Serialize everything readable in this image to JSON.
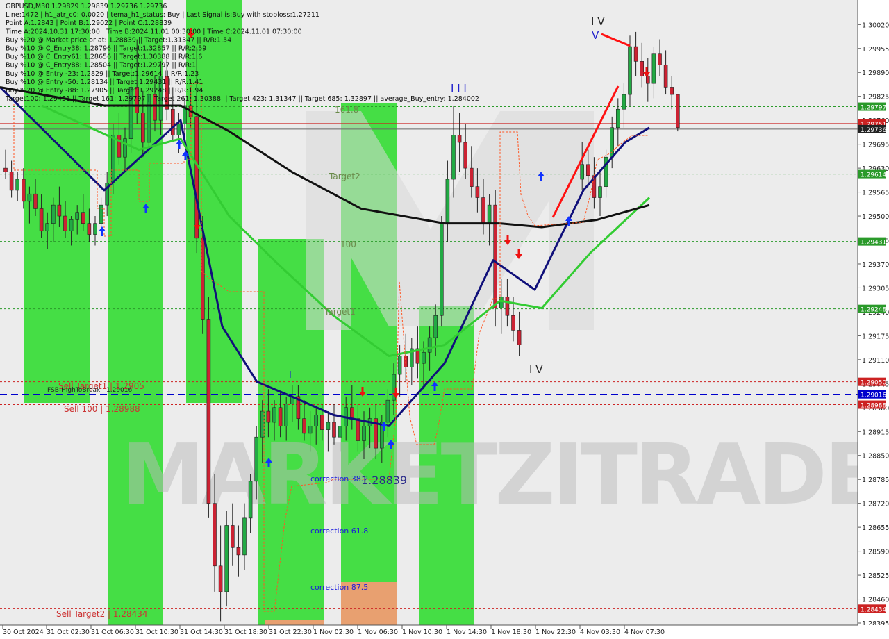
{
  "colors": {
    "background": "#ffffff",
    "plot_bg": "#ececec",
    "zone_green": "#33dd33",
    "zone_orange": "#e8a070",
    "bull": "#22aa44",
    "bear": "#cc2233",
    "ma_navy": "#10107a",
    "ma_green": "#33cc33",
    "ma_black": "#111111",
    "level_green": "#2a9a2a",
    "level_red": "#cc2222",
    "level_blue": "#0000cc"
  },
  "header_lines": [
    "GBPUSD,M30  1.29829 1.29839 1.29736 1.29736",
    "Line:1472 | h1_atr_c0: 0.0020 | tema_h1_status: Buy | Last Signal is:Buy with stoploss:1.27211",
    "Point A:1.2843 | Point B:1.29022 | Point C:1.28839",
    "Time A:2024.10.31 17:30:00 | Time B:2024.11.01 00:30:00 | Time C:2024.11.01 07:30:00",
    "Buy %20 @ Market price or at: 1.28839 || Target:1.31347 || R/R:1.54",
    "Buy %10 @ C_Entry38: 1.28796 || Target:1.32857 || R/R:2.59",
    "Buy %10 @ C_Entry61: 1.28656 || Target:1.30388 || R/R:1.6",
    "Buy %10 @ C_Entry88: 1.28504 || Target:1.29797 || R/R:1",
    "Buy %10 @ Entry -23: 1.2829 || Target:1.29614 || R/R:1.23",
    "Buy %10 @ Entry -50: 1.28134 || Target:1.29431 || R/R:1.41",
    "Buy %20 @ Entry -88: 1.27905 || Target:1.29248 || R/R:1.94",
    "Target100: 1.29431 || Target 161: 1.29797 || Target 261: 1.30388 || Target 423: 1.31347 || Target 685: 1.32897 || average_Buy_entry: 1.284002"
  ],
  "chart_data": {
    "type": "candlestick",
    "symbol": "GBPUSD",
    "timeframe": "M30",
    "ylim": [
      1.28395,
      1.3003
    ],
    "y_ticks": [
      "1.30020",
      "1.29955",
      "1.29890",
      "1.29825",
      "1.29760",
      "1.29695",
      "1.29630",
      "1.29565",
      "1.29500",
      "1.29435",
      "1.29370",
      "1.29305",
      "1.29240",
      "1.29175",
      "1.29110",
      "1.29045",
      "1.28980",
      "1.28915",
      "1.28850",
      "1.28785",
      "1.28720",
      "1.28655",
      "1.28590",
      "1.28525",
      "1.28460",
      "1.28395"
    ],
    "x_ticks": [
      "30 Oct 2024",
      "31 Oct 02:30",
      "31 Oct 06:30",
      "31 Oct 10:30",
      "31 Oct 14:30",
      "31 Oct 18:30",
      "31 Oct 22:30",
      "1 Nov 02:30",
      "1 Nov 06:30",
      "1 Nov 10:30",
      "1 Nov 14:30",
      "1 Nov 18:30",
      "1 Nov 22:30",
      "4 Nov 03:30",
      "4 Nov 07:30"
    ],
    "price_levels": [
      {
        "value": 1.29797,
        "label": "1.29797",
        "kind": "green"
      },
      {
        "value": 1.29751,
        "label": "1.29751",
        "kind": "red"
      },
      {
        "value": 1.29736,
        "label": "1.29736",
        "kind": "current"
      },
      {
        "value": 1.29614,
        "label": "1.29614",
        "kind": "green"
      },
      {
        "value": 1.29431,
        "label": "1.29431",
        "kind": "green"
      },
      {
        "value": 1.29248,
        "label": "1.29248",
        "kind": "green"
      },
      {
        "value": 1.2905,
        "label": "1.29050",
        "kind": "red"
      },
      {
        "value": 1.29016,
        "label": "1.29016",
        "kind": "blue"
      },
      {
        "value": 1.28988,
        "label": "1.28988",
        "kind": "red"
      },
      {
        "value": 1.28434,
        "label": "1.28434",
        "kind": "red"
      }
    ],
    "candles": [
      [
        1.2963,
        1.2968,
        1.296,
        1.2962
      ],
      [
        1.2962,
        1.2965,
        1.2955,
        1.2957
      ],
      [
        1.2957,
        1.2962,
        1.2954,
        1.296
      ],
      [
        1.296,
        1.2963,
        1.2952,
        1.2954
      ],
      [
        1.2954,
        1.2958,
        1.2948,
        1.2956
      ],
      [
        1.2956,
        1.296,
        1.295,
        1.2952
      ],
      [
        1.2952,
        1.2956,
        1.2944,
        1.2946
      ],
      [
        1.2946,
        1.2951,
        1.2941,
        1.2948
      ],
      [
        1.2948,
        1.2955,
        1.2943,
        1.2953
      ],
      [
        1.2953,
        1.2958,
        1.2947,
        1.295
      ],
      [
        1.295,
        1.2954,
        1.2944,
        1.2946
      ],
      [
        1.2946,
        1.295,
        1.2942,
        1.2949
      ],
      [
        1.2949,
        1.2953,
        1.2945,
        1.2951
      ],
      [
        1.2951,
        1.2956,
        1.2946,
        1.2948
      ],
      [
        1.2948,
        1.2952,
        1.2943,
        1.2945
      ],
      [
        1.2945,
        1.295,
        1.2942,
        1.2948
      ],
      [
        1.2948,
        1.2955,
        1.2945,
        1.2953
      ],
      [
        1.2953,
        1.2962,
        1.295,
        1.2959
      ],
      [
        1.2959,
        1.2975,
        1.2956,
        1.2972
      ],
      [
        1.2972,
        1.2978,
        1.2964,
        1.2966
      ],
      [
        1.2966,
        1.2974,
        1.2962,
        1.2971
      ],
      [
        1.2971,
        1.299,
        1.2967,
        1.2985
      ],
      [
        1.2985,
        1.2998,
        1.2975,
        1.2978
      ],
      [
        1.2978,
        1.2984,
        1.2966,
        1.297
      ],
      [
        1.297,
        1.2986,
        1.2967,
        1.2983
      ],
      [
        1.2983,
        1.2988,
        1.2973,
        1.2976
      ],
      [
        1.2976,
        1.2992,
        1.2972,
        1.2988
      ],
      [
        1.2988,
        1.2993,
        1.2976,
        1.2979
      ],
      [
        1.2979,
        1.2985,
        1.297,
        1.2972
      ],
      [
        1.2972,
        1.2978,
        1.2967,
        1.2975
      ],
      [
        1.2975,
        1.2982,
        1.2971,
        1.298
      ],
      [
        1.298,
        1.2985,
        1.2974,
        1.2977
      ],
      [
        1.2977,
        1.2996,
        1.294,
        1.2944
      ],
      [
        1.2944,
        1.295,
        1.2918,
        1.2922
      ],
      [
        1.2922,
        1.2928,
        1.2868,
        1.2872
      ],
      [
        1.2872,
        1.288,
        1.2848,
        1.2855
      ],
      [
        1.2855,
        1.2866,
        1.284,
        1.2848
      ],
      [
        1.2848,
        1.287,
        1.2844,
        1.2866
      ],
      [
        1.2866,
        1.2872,
        1.2855,
        1.286
      ],
      [
        1.286,
        1.2866,
        1.2852,
        1.2858
      ],
      [
        1.2858,
        1.2872,
        1.2854,
        1.2868
      ],
      [
        1.2868,
        1.288,
        1.2864,
        1.2878
      ],
      [
        1.2878,
        1.2893,
        1.2873,
        1.289
      ],
      [
        1.289,
        1.29,
        1.2883,
        1.2897
      ],
      [
        1.2897,
        1.2903,
        1.289,
        1.2894
      ],
      [
        1.2894,
        1.29,
        1.2889,
        1.2898
      ],
      [
        1.2898,
        1.2902,
        1.289,
        1.2893
      ],
      [
        1.2893,
        1.2901,
        1.2889,
        1.2899
      ],
      [
        1.2899,
        1.2904,
        1.2894,
        1.2901
      ],
      [
        1.2901,
        1.2904,
        1.2892,
        1.2895
      ],
      [
        1.2895,
        1.29,
        1.2889,
        1.2891
      ],
      [
        1.2891,
        1.2897,
        1.2886,
        1.2893
      ],
      [
        1.2893,
        1.2898,
        1.2888,
        1.2896
      ],
      [
        1.2896,
        1.2899,
        1.2889,
        1.2892
      ],
      [
        1.2892,
        1.2897,
        1.2886,
        1.2894
      ],
      [
        1.2894,
        1.2899,
        1.2888,
        1.289
      ],
      [
        1.289,
        1.2896,
        1.2886,
        1.2893
      ],
      [
        1.2893,
        1.2901,
        1.2889,
        1.2898
      ],
      [
        1.2898,
        1.2904,
        1.2892,
        1.2895
      ],
      [
        1.2895,
        1.2899,
        1.2886,
        1.2889
      ],
      [
        1.2889,
        1.2897,
        1.2884,
        1.2893
      ],
      [
        1.2893,
        1.2898,
        1.2887,
        1.2895
      ],
      [
        1.2895,
        1.2899,
        1.2884,
        1.2887
      ],
      [
        1.2887,
        1.2896,
        1.2883,
        1.2894
      ],
      [
        1.2894,
        1.2903,
        1.289,
        1.29
      ],
      [
        1.29,
        1.291,
        1.2896,
        1.2907
      ],
      [
        1.2907,
        1.2915,
        1.2901,
        1.2912
      ],
      [
        1.2912,
        1.2918,
        1.2905,
        1.2909
      ],
      [
        1.2909,
        1.2917,
        1.2904,
        1.2914
      ],
      [
        1.2914,
        1.292,
        1.2906,
        1.291
      ],
      [
        1.291,
        1.2916,
        1.2903,
        1.2913
      ],
      [
        1.2913,
        1.292,
        1.2908,
        1.2917
      ],
      [
        1.2917,
        1.2926,
        1.2912,
        1.2923
      ],
      [
        1.2923,
        1.295,
        1.292,
        1.2948
      ],
      [
        1.2948,
        1.2965,
        1.2943,
        1.296
      ],
      [
        1.296,
        1.298,
        1.2955,
        1.2972
      ],
      [
        1.2972,
        1.2978,
        1.2962,
        1.297
      ],
      [
        1.297,
        1.2975,
        1.296,
        1.2963
      ],
      [
        1.2963,
        1.2969,
        1.2955,
        1.2958
      ],
      [
        1.2958,
        1.2963,
        1.2951,
        1.2955
      ],
      [
        1.2955,
        1.296,
        1.2945,
        1.2948
      ],
      [
        1.2948,
        1.2956,
        1.2942,
        1.2953
      ],
      [
        1.2953,
        1.2957,
        1.292,
        1.2925
      ],
      [
        1.2925,
        1.2933,
        1.2918,
        1.2928
      ],
      [
        1.2928,
        1.2933,
        1.292,
        1.2923
      ],
      [
        1.2923,
        1.2928,
        1.2916,
        1.2919
      ],
      [
        1.2919,
        1.2924,
        1.2912,
        1.2915
      ],
      [
        1.296,
        1.297,
        1.2957,
        1.2964
      ],
      [
        1.2964,
        1.2968,
        1.2958,
        1.2961
      ],
      [
        1.2961,
        1.2966,
        1.2952,
        1.2955
      ],
      [
        1.2955,
        1.2962,
        1.295,
        1.2958
      ],
      [
        1.2958,
        1.2968,
        1.2955,
        1.2966
      ],
      [
        1.2966,
        1.2977,
        1.2963,
        1.2974
      ],
      [
        1.2974,
        1.2982,
        1.2969,
        1.2979
      ],
      [
        1.2979,
        1.2986,
        1.2974,
        1.2983
      ],
      [
        1.2983,
        1.2999,
        1.298,
        1.2996
      ],
      [
        1.2996,
        1.3,
        1.2988,
        1.2992
      ],
      [
        1.2992,
        1.2997,
        1.2985,
        1.2988
      ],
      [
        1.2988,
        1.2993,
        1.2981,
        1.2986
      ],
      [
        1.2986,
        1.2996,
        1.2982,
        1.2994
      ],
      [
        1.2994,
        1.2998,
        1.2988,
        1.2991
      ],
      [
        1.2991,
        1.2995,
        1.2983,
        1.2985
      ],
      [
        1.2985,
        1.2988,
        1.2979,
        1.2983
      ],
      [
        1.2983,
        1.2983,
        1.2973,
        1.2974
      ]
    ],
    "moving_averages": [
      {
        "name": "navy",
        "points": [
          [
            0,
            1.2985
          ],
          [
            150,
            1.2957
          ],
          [
            260,
            1.2976
          ],
          [
            320,
            1.292
          ],
          [
            370,
            1.2905
          ],
          [
            420,
            1.2901
          ],
          [
            480,
            1.2896
          ],
          [
            560,
            1.2893
          ],
          [
            640,
            1.291
          ],
          [
            710,
            1.2938
          ],
          [
            770,
            1.293
          ],
          [
            840,
            1.2957
          ],
          [
            900,
            1.297
          ],
          [
            935,
            1.2974
          ]
        ]
      },
      {
        "name": "green",
        "points": [
          [
            60,
            1.298
          ],
          [
            200,
            1.2968
          ],
          [
            260,
            1.2971
          ],
          [
            330,
            1.295
          ],
          [
            400,
            1.2937
          ],
          [
            480,
            1.2923
          ],
          [
            560,
            1.2912
          ],
          [
            640,
            1.2915
          ],
          [
            720,
            1.2927
          ],
          [
            780,
            1.2925
          ],
          [
            850,
            1.294
          ],
          [
            935,
            1.2955
          ]
        ]
      },
      {
        "name": "black",
        "points": [
          [
            0,
            1.2985
          ],
          [
            150,
            1.298
          ],
          [
            260,
            1.298
          ],
          [
            330,
            1.2973
          ],
          [
            420,
            1.2962
          ],
          [
            520,
            1.2952
          ],
          [
            640,
            1.2948
          ],
          [
            720,
            1.2948
          ],
          [
            780,
            1.2947
          ],
          [
            860,
            1.2949
          ],
          [
            935,
            1.2953
          ]
        ]
      }
    ]
  },
  "chart_texts": {
    "wave_iv_top": "I V",
    "wave_v": "V",
    "wave_iii": "I I I",
    "wave_iv_bottom": "I V",
    "wave_i": "I",
    "fib_1618": "161.8",
    "target2": "Target2",
    "fib_100": "100",
    "target1": "Target1",
    "sell_target1": "Sell Target1 | 1.2905",
    "fsb_label": "FSB-HighToBreak | 1.29016",
    "sell_100": "Sell 100 | 1.28988",
    "sell_target2": "Sell Target2 | 1.28434",
    "correction_382": "correction 38.2",
    "point_c_value": "1.28839",
    "correction_618": "correction 61.8",
    "correction_875": "correction 87.5",
    "watermark": "MARKETZITRADE"
  }
}
